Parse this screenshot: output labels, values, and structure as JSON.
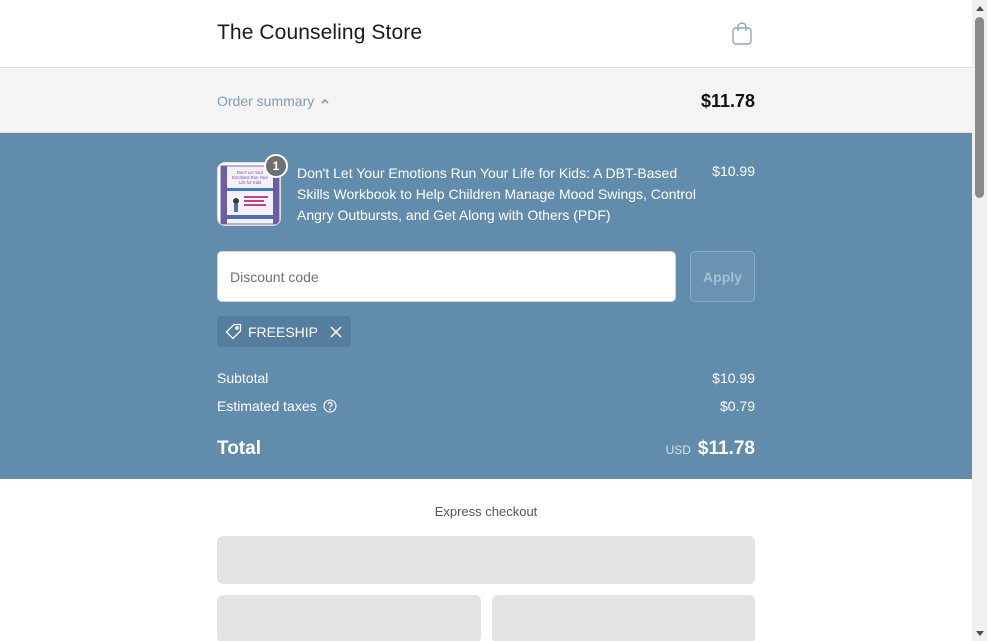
{
  "store": {
    "title": "The Counseling Store",
    "cart_icon": "shopping-bag-icon"
  },
  "summary_bar": {
    "toggle_label": "Order summary",
    "toggle_icon": "chevron-up-icon",
    "total": "$11.78"
  },
  "product": {
    "title": "Don't Let Your Emotions Run Your Life for Kids: A DBT-Based Skills Workbook to Help Children Manage Mood Swings, Control Angry Outbursts, and Get Along with Others (PDF)",
    "price": "$10.99",
    "quantity": "1",
    "cover_lines": [
      "Don't Let Your",
      "Emotions Run Your",
      "Life for Kids"
    ]
  },
  "discount": {
    "placeholder": "Discount code",
    "apply_label": "Apply"
  },
  "applied_code": {
    "code": "FREESHIP",
    "icon": "tag-icon",
    "remove_icon": "close-icon"
  },
  "totals": {
    "subtotal_label": "Subtotal",
    "subtotal_value": "$10.99",
    "taxes_label": "Estimated taxes",
    "taxes_icon": "help-circle-icon",
    "taxes_value": "$0.79",
    "total_label": "Total",
    "currency": "USD",
    "total_value": "$11.78"
  },
  "express": {
    "label": "Express checkout"
  },
  "colors": {
    "panel": "#628cac",
    "accent_text": "#7d9db8",
    "placeholder_button": "#e3e3e3"
  }
}
